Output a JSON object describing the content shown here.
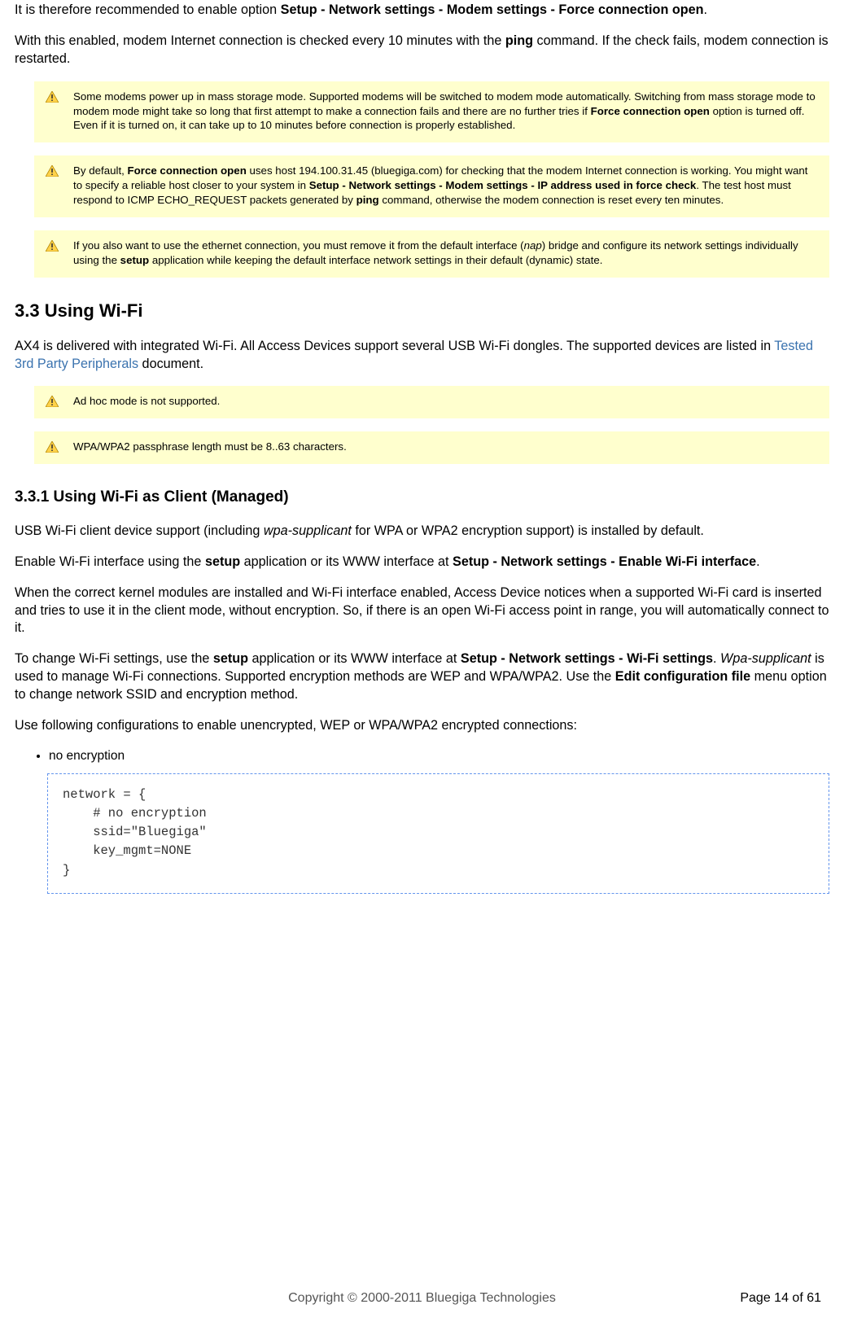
{
  "intro": {
    "p1_pre": "It is therefore recommended to enable option ",
    "p1_bold": "Setup - Network settings - Modem settings - Force connection open",
    "p1_post": ".",
    "p2_pre": "With this enabled, modem Internet connection is checked every 10 minutes with the ",
    "p2_bold": "ping",
    "p2_post": " command. If the check fails, modem connection is restarted."
  },
  "notes1": {
    "n1_a": "Some modems power up in mass storage mode. Supported modems will be switched to modem mode automatically. Switching from mass storage mode to modem mode might take so long that first attempt to make a connection fails and there are no further tries if ",
    "n1_b": "Force connection open",
    "n1_c": " option is turned off. Even if it is turned on, it can take up to 10 minutes before connection is properly established.",
    "n2_a": "By default, ",
    "n2_b": "Force connection open",
    "n2_c": " uses host 194.100.31.45 (bluegiga.com) for checking that the modem Internet connection is working. You might want to specify a reliable host closer to your system in ",
    "n2_d": "Setup - Network settings - Modem settings - IP address used in force check",
    "n2_e": ". The test host must respond to ICMP ECHO_REQUEST packets generated by ",
    "n2_f": "ping",
    "n2_g": " command, otherwise the modem connection is reset every ten minutes.",
    "n3_a": "If you also want to use the ethernet connection, you must remove it from the default interface (",
    "n3_b": "nap",
    "n3_c": ") bridge and configure its network settings individually using the ",
    "n3_d": "setup",
    "n3_e": " application while keeping the default interface network settings in their default (dynamic) state."
  },
  "sec33": {
    "title": "3.3 Using Wi-Fi",
    "p1_a": "AX4 is delivered with integrated Wi-Fi. All Access Devices support several USB Wi-Fi dongles. The supported devices are listed in ",
    "p1_link": "Tested 3rd Party Peripherals",
    "p1_b": " document.",
    "note1": "Ad hoc mode is not supported.",
    "note2": "WPA/WPA2 passphrase length must be 8..63 characters."
  },
  "sec331": {
    "title": "3.3.1 Using Wi-Fi as Client (Managed)",
    "p1_a": "USB Wi-Fi client device support (including ",
    "p1_i": "wpa-supplicant",
    "p1_b": " for WPA or WPA2 encryption support) is installed by default.",
    "p2_a": "Enable Wi-Fi interface using the ",
    "p2_b": "setup",
    "p2_c": " application or its WWW interface at ",
    "p2_d": "Setup - Network settings - Enable Wi-Fi interface",
    "p2_e": ".",
    "p3": "When the correct kernel modules are installed and Wi-Fi interface enabled, Access Device notices when a supported Wi-Fi card is inserted and tries to use it in the client mode, without encryption. So, if there is an open Wi-Fi access point in range, you will automatically connect to it.",
    "p4_a": "To change Wi-Fi settings, use the ",
    "p4_b": "setup",
    "p4_c": " application or its WWW interface at ",
    "p4_d": "Setup - Network settings - Wi-Fi settings",
    "p4_e": ". ",
    "p4_f": "Wpa-supplicant",
    "p4_g": " is used to manage Wi-Fi connections. Supported encryption methods are WEP and WPA/WPA2. Use the ",
    "p4_h": "Edit configuration file",
    "p4_i": " menu option to change network SSID and encryption method.",
    "p5": "Use following configurations to enable unencrypted, WEP or WPA/WPA2 encrypted connections:",
    "bullet1": "no encryption",
    "code1": "network = {\n    # no encryption\n    ssid=\"Bluegiga\"\n    key_mgmt=NONE\n}"
  },
  "footer": {
    "copyright": "Copyright © 2000-2011 Bluegiga Technologies",
    "page": "Page 14 of 61"
  }
}
